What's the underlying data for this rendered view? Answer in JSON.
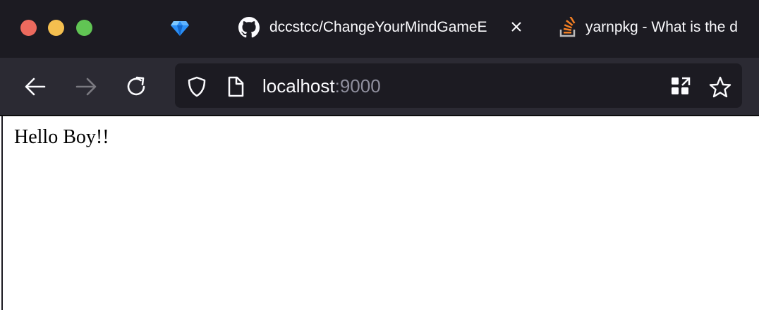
{
  "window": {
    "controls": [
      "close",
      "minimize",
      "maximize"
    ]
  },
  "tabs": [
    {
      "icon": "diamond-favicon-icon",
      "title": ""
    },
    {
      "icon": "github-icon",
      "title": "dccstcc/ChangeYourMindGameE",
      "active": true
    },
    {
      "icon": "stackoverflow-icon",
      "title": "yarnpkg - What is the d"
    }
  ],
  "navbar": {
    "url_host": "localhost",
    "url_port": ":9000",
    "back_enabled": true,
    "forward_enabled": false
  },
  "page": {
    "text": "Hello Boy!!"
  },
  "colors": {
    "chrome_dark": "#1c1b22",
    "toolbar": "#2b2a33",
    "text_light": "#fbfbfe",
    "text_dim": "#8f8f9d"
  }
}
